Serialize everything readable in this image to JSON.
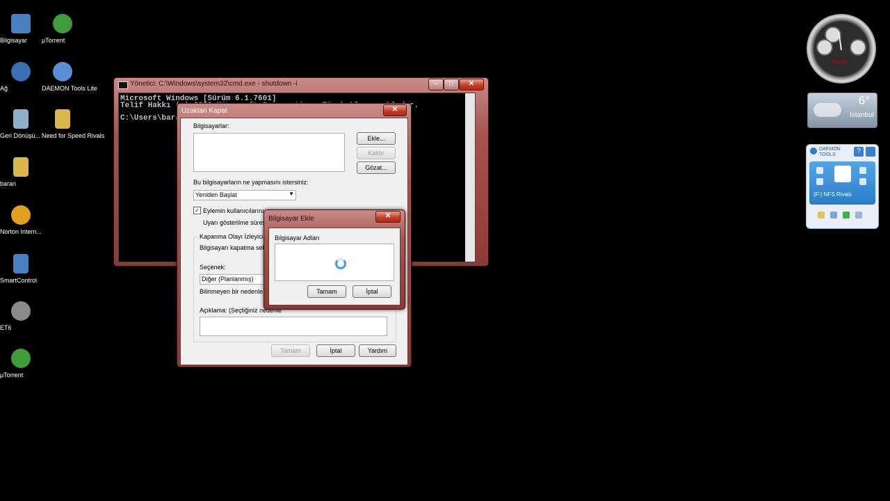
{
  "desktop_icons": [
    {
      "label": "Bilgisayar",
      "color": "#4a7fc1"
    },
    {
      "label": "μTorrent",
      "color": "#3f9c3a"
    },
    {
      "label": "Ağ",
      "color": "#3a6fb3"
    },
    {
      "label": "DAEMON Tools Lite",
      "color": "#5a8fd6"
    },
    {
      "label": "Geri Dönüşü...",
      "color": "#8fb0c8"
    },
    {
      "label": "Need for Speed Rivals",
      "color": "#d9b74c"
    },
    {
      "label": "baran",
      "color": "#d9b74c"
    },
    {
      "label": "Norton Intern...",
      "color": "#e0a020"
    },
    {
      "label": "SmartControl",
      "color": "#4a7fc1"
    },
    {
      "label": "ET6",
      "color": "#8a8a8a"
    },
    {
      "label": "μTorrent",
      "color": "#3f9c3a"
    }
  ],
  "cmd_window": {
    "title": "Yönetici: C:\\Windows\\system32\\cmd.exe - shutdown -i",
    "lines": [
      "Microsoft Windows [Sürüm 6.1.7601]",
      "Telif Hakkı (c) 2009 Microsoft Corporation. Tüm hakları saklıdır.",
      "",
      "C:\\Users\\baran>"
    ]
  },
  "remote_shutdown": {
    "title": "Uzaktan Kapat",
    "computers_label": "Bilgisayarlar:",
    "add_button": "Ekle...",
    "remove_button": "Kaldır",
    "browse_button": "Gözat...",
    "action_question": "Bu bilgisayarların ne yapmasını istersiniz:",
    "action_value": "Yeniden Başlat",
    "warn_users_label": "Eylemin kullanıcılarını uyar",
    "warn_time_label": "Uyarı gösterilme süresi:",
    "event_tracker_title": "Kapanma Olayı İzleyicisi",
    "reason_label": "Bilgisayarı kapatma sebebi",
    "option_label": "Seçenek:",
    "option_value": "Diğer (Planlanmış)",
    "option_note": "Bilinmeyen bir nedenle kapatma",
    "comment_label": "Açıklama: (Seçtiğiniz nedenle",
    "ok_button": "Tamam",
    "cancel_button": "İptal",
    "help_button": "Yardım"
  },
  "add_computer": {
    "title": "Bilgisayar Ekle",
    "names_label": "Bilgisayar Adları",
    "ok_button": "Tamam",
    "cancel_button": "İptal"
  },
  "weather": {
    "temperature": "6°",
    "city": "İstanbul"
  },
  "clock": {
    "label": "baran"
  },
  "daemon_gadget": {
    "brand": "DAEMON TOOLS",
    "drive_label": "(F:) NFS Rivals"
  }
}
